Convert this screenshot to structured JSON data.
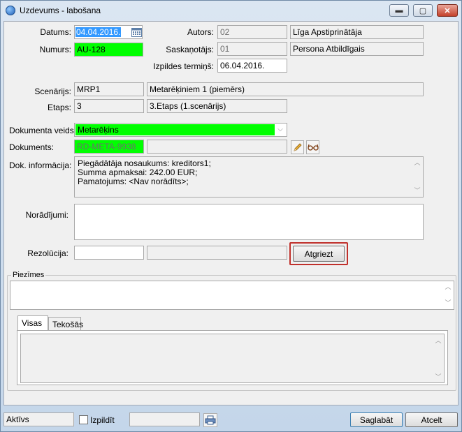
{
  "window": {
    "title": "Uzdevums - labošana",
    "minimize": "▬",
    "maximize": "▢",
    "close": "✕"
  },
  "form": {
    "datums_label": "Datums:",
    "datums_value": "04.04.2016.",
    "numurs_label": "Numurs:",
    "numurs_value": "AU-128",
    "autors_label": "Autors:",
    "autors_code": "02",
    "autors_name": "Līga Apstiprinātāja",
    "saskanotajs_label": "Saskaņotājs:",
    "saskanotajs_code": "01",
    "saskanotajs_name": "Persona Atbildīgais",
    "termins_label": "Izpildes termiņš:",
    "termins_value": "06.04.2016.",
    "scenarijs_label": "Scenārijs:",
    "scenarijs_code": "MRP1",
    "scenarijs_name": "Metarēķiniem 1 (piemērs)",
    "etaps_label": "Etaps:",
    "etaps_code": "3",
    "etaps_name": "3.Etaps (1.scenārijs)",
    "dok_veids_label": "Dokumenta veids:",
    "dok_veids_value": "Metarēķins",
    "dokuments_label": "Dokuments:",
    "dokuments_code": "RD-META-9938",
    "dokuments_name": "",
    "dok_info_label": "Dok. informācija:",
    "dok_info_lines": [
      "Piegādātāja nosaukums: kreditors1;",
      "Summa apmaksai: 242.00 EUR;",
      "Pamatojums: <Nav norādīts>;"
    ],
    "noradijumi_label": "Norādījumi:",
    "noradijumi_value": "",
    "rezolucija_label": "Rezolūcija:",
    "rezolucija_value": "",
    "rezolucija_name": "",
    "atgriezt_label": "Atgriezt"
  },
  "piezimes": {
    "legend": "Piezīmes",
    "value": "",
    "tabs": [
      "Visas",
      "Tekošās"
    ]
  },
  "status": {
    "state": "Aktīvs",
    "izpildit_label": "Izpildīt",
    "blank_field": "",
    "save_label": "Saglabāt",
    "cancel_label": "Atcelt"
  },
  "colors": {
    "required_green": "#00ff00",
    "selection_blue": "#3399ff",
    "highlight_border": "#c0302b"
  },
  "icons": {
    "calendar": "calendar-icon",
    "edit": "pencil-icon",
    "view": "glasses-icon",
    "print": "printer-icon",
    "dropdown": "chevron-down-icon"
  }
}
